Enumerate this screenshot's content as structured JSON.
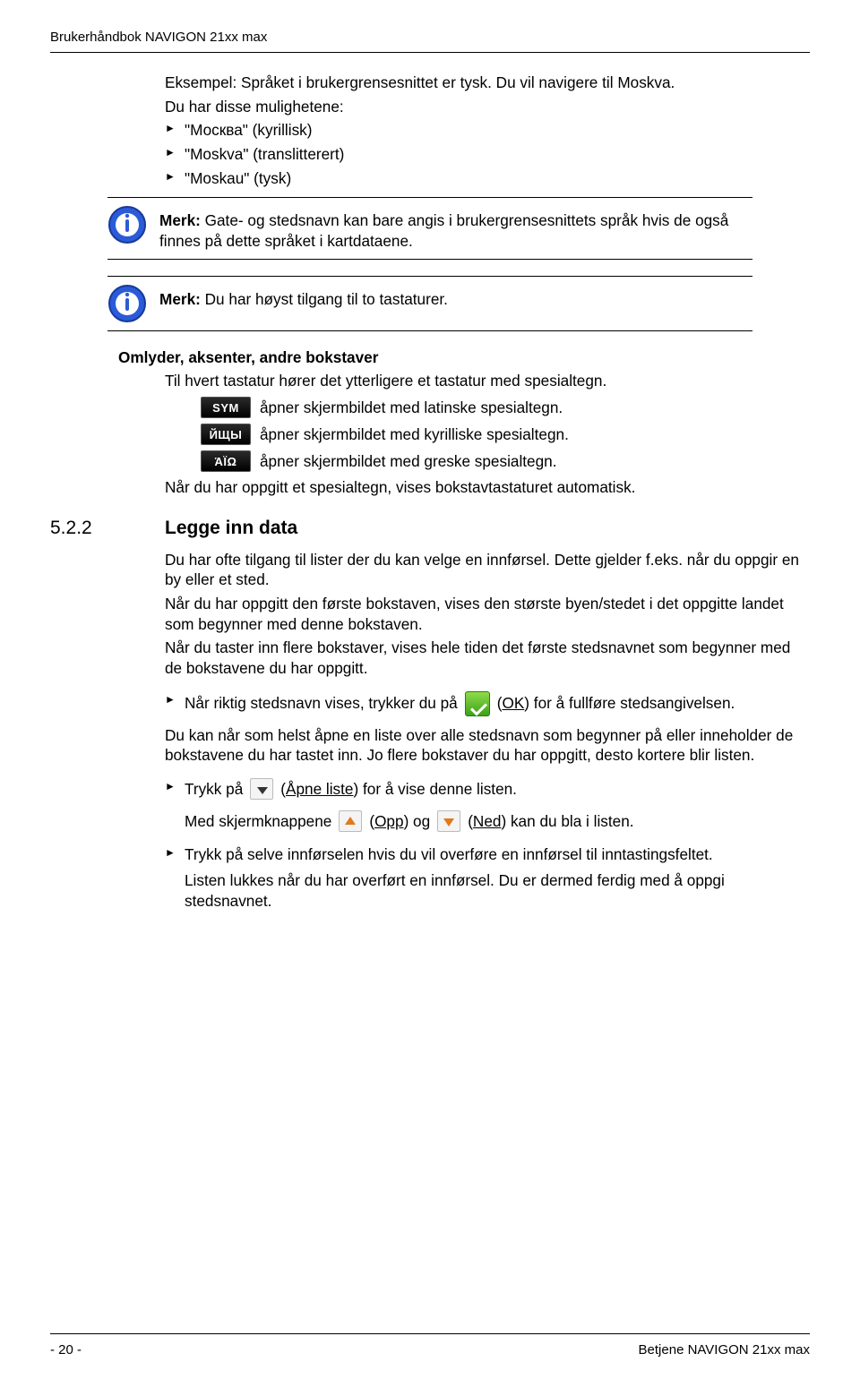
{
  "header": {
    "title": "Brukerhåndbok NAVIGON 21xx max"
  },
  "intro": {
    "example": "Eksempel: Språket i brukergrensesnittet er tysk. Du vil navigere til Moskva.",
    "options_lead": "Du har disse mulighetene:",
    "options": [
      "\"Москва\" (kyrillisk)",
      "\"Moskva\" (translitterert)",
      "\"Moskau\" (tysk)"
    ]
  },
  "note1": {
    "label": "Merk:",
    "text": " Gate- og stedsnavn kan bare angis i brukergrensesnittets språk hvis de også finnes på dette språket i kartdataene."
  },
  "note2": {
    "label": "Merk:",
    "text": " Du har høyst tilgang til to tastaturer."
  },
  "omlyder": {
    "heading": "Omlyder, aksenter, andre bokstaver",
    "intro": "Til hvert tastatur hører det ytterligere et tastatur med spesialtegn.",
    "sym_key": "SYM",
    "sym_text": " åpner skjermbildet med latinske spesialtegn.",
    "cyr_key": "ЙЩЫ",
    "cyr_text": " åpner skjermbildet med kyrilliske spesialtegn.",
    "grk_key": "ΆΪΩ",
    "grk_text": " åpner skjermbildet med greske spesialtegn.",
    "auto": "Når du har oppgitt et spesialtegn, vises bokstavtastaturet automatisk."
  },
  "chapter": {
    "num": "5.2.2",
    "title": "Legge inn data"
  },
  "legge": {
    "p1": "Du har ofte tilgang til lister der du kan velge en innførsel. Dette gjelder f.eks. når du oppgir en by eller et sted.",
    "p2": "Når du har oppgitt den første bokstaven, vises den største byen/stedet i det oppgitte landet som begynner med denne bokstaven.",
    "p3": "Når du taster inn flere bokstaver, vises hele tiden det første stedsnavnet som begynner med de bokstavene du har oppgitt.",
    "step_ok_pre": "Når riktig stedsnavn vises, trykker du på ",
    "ok_label": "OK",
    "step_ok_post": ") for å fullføre stedsangivelsen.",
    "p4": "Du kan når som helst åpne en liste over alle stedsnavn som begynner på eller inneholder de bokstavene du har tastet inn. Jo flere bokstaver du har oppgitt, desto kortere blir listen.",
    "step_open_pre": "Trykk på ",
    "open_label": "Åpne liste",
    "step_open_post": ") for å vise denne listen.",
    "arrows_pre": "Med skjermknappene ",
    "up_label": "Opp",
    "arrows_mid": ") og ",
    "down_label": "Ned",
    "arrows_post": ") kan du bla i listen.",
    "step_transfer": "Trykk på selve innførselen hvis du vil overføre en innførsel til inntastingsfeltet.",
    "close": "Listen lukkes når du har overført en innførsel. Du er dermed ferdig med å oppgi stedsnavnet."
  },
  "footer": {
    "left": "- 20 -",
    "right": "Betjene NAVIGON 21xx max"
  }
}
